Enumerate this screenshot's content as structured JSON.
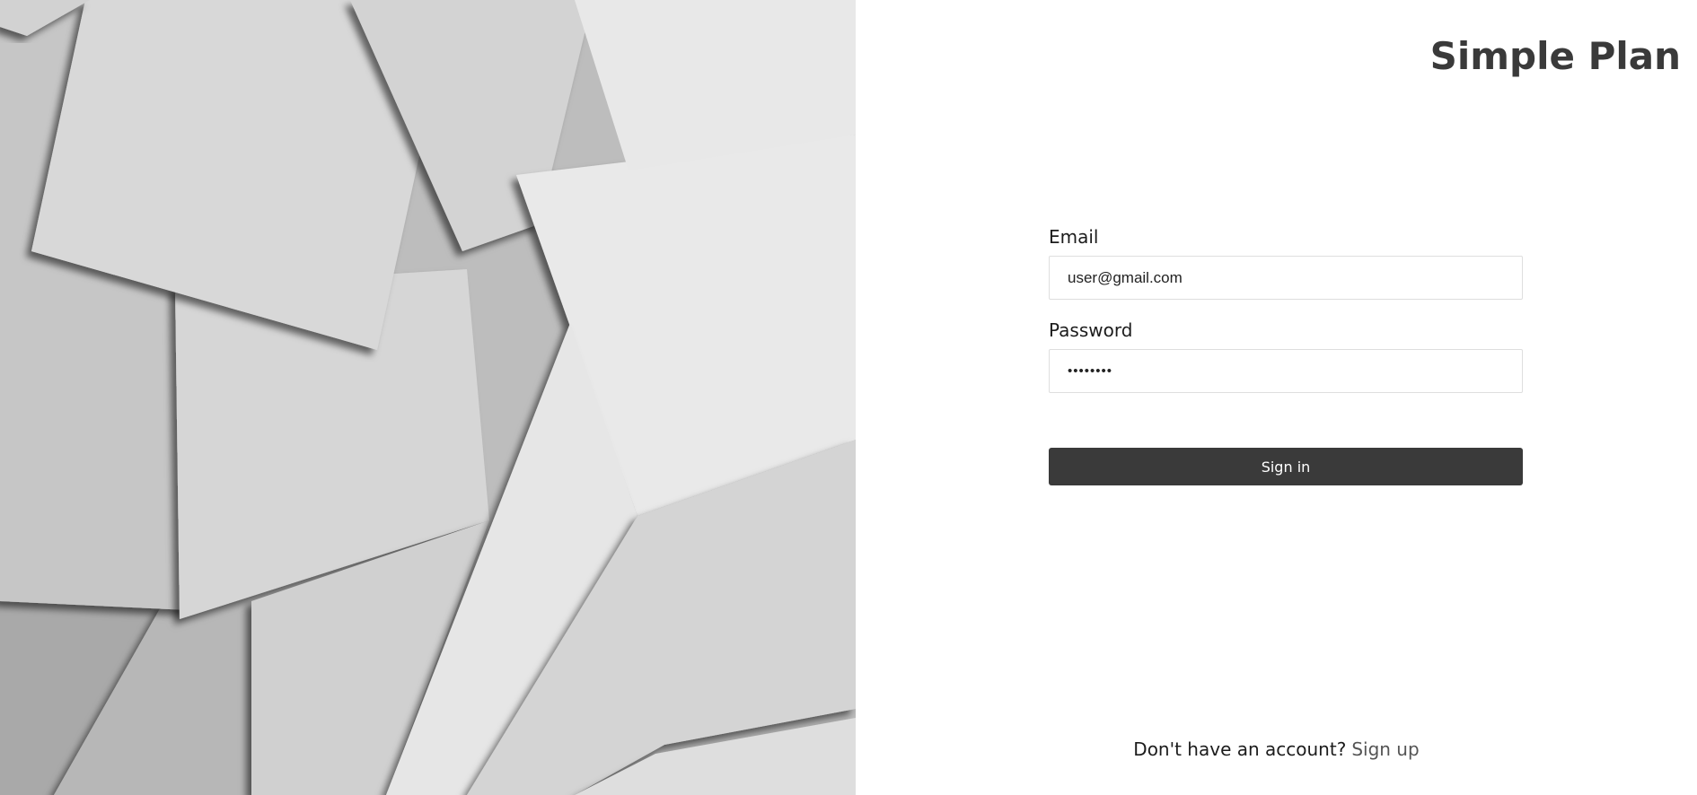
{
  "app": {
    "brand": "Simple Plan"
  },
  "login_form": {
    "email_label": "Email",
    "email_value": "user@gmail.com",
    "password_label": "Password",
    "password_value": "••••••••",
    "signin_label": "Sign in"
  },
  "footer": {
    "prompt": "Don't have an account?",
    "signup_label": "Sign up"
  },
  "colors": {
    "button_bg": "#3a3a3a",
    "brand_text": "#3a3a3a",
    "input_border": "#dedede"
  }
}
